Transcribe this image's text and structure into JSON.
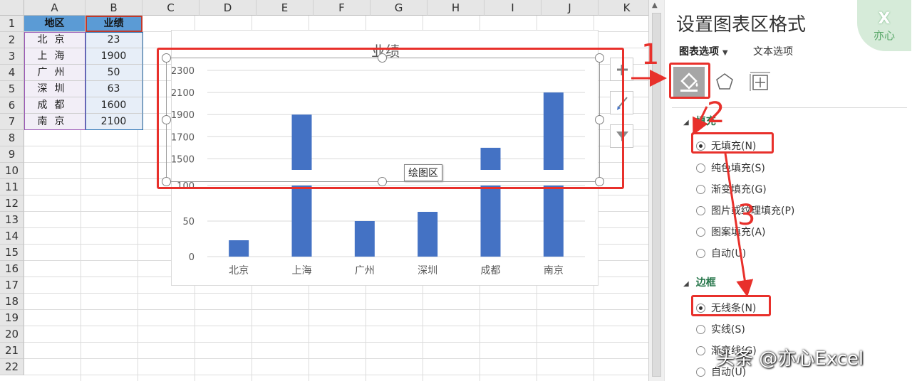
{
  "spreadsheet": {
    "columns": [
      "A",
      "B",
      "C",
      "D",
      "E",
      "F",
      "G",
      "H",
      "I",
      "J",
      "K"
    ],
    "rows": [
      "1",
      "2",
      "3",
      "4",
      "5",
      "6",
      "7",
      "8",
      "9",
      "10",
      "11",
      "12",
      "13",
      "14",
      "15",
      "16",
      "17",
      "18",
      "19",
      "20",
      "21",
      "22"
    ],
    "header": {
      "region": "地区",
      "sales": "业绩"
    },
    "data_rows": [
      {
        "region": "北京",
        "value": "23"
      },
      {
        "region": "上海",
        "value": "1900"
      },
      {
        "region": "广州",
        "value": "50"
      },
      {
        "region": "深圳",
        "value": "63"
      },
      {
        "region": "成都",
        "value": "1600"
      },
      {
        "region": "南京",
        "value": "2100"
      }
    ]
  },
  "chart_data": {
    "type": "bar",
    "title": "业绩",
    "categories": [
      "北京",
      "上海",
      "广州",
      "深圳",
      "成都",
      "南京"
    ],
    "values": [
      23,
      1900,
      50,
      63,
      1600,
      2100
    ],
    "axis_break": true,
    "upper_ylim": [
      1400,
      2300
    ],
    "upper_ticks": [
      "2300",
      "2100",
      "1900",
      "1700",
      "1500"
    ],
    "lower_ylim": [
      0,
      100
    ],
    "lower_ticks": [
      "100",
      "50",
      "0"
    ],
    "color": "#4472c4",
    "grid": true
  },
  "chart_ui": {
    "plot_area_tooltip": "绘图区",
    "side_buttons": [
      "plus-icon",
      "brush-icon",
      "filter-icon"
    ]
  },
  "annotations": {
    "step1": "1",
    "step2": "2",
    "step3": "3",
    "color": "#e8302b"
  },
  "panel": {
    "title": "设置图表区格式",
    "tab_chart_options": "图表选项",
    "tab_text_options": "文本选项",
    "icons": [
      "fill-line-icon",
      "effects-icon",
      "size-properties-icon"
    ],
    "fill_section": "填充",
    "fill_options": [
      {
        "label": "无填充(N)",
        "selected": true
      },
      {
        "label": "纯色填充(S)",
        "selected": false
      },
      {
        "label": "渐变填充(G)",
        "selected": false
      },
      {
        "label": "图片或纹理填充(P)",
        "selected": false
      },
      {
        "label": "图案填充(A)",
        "selected": false
      },
      {
        "label": "自动(U)",
        "selected": false
      }
    ],
    "border_section": "边框",
    "border_options": [
      {
        "label": "无线条(N)",
        "selected": true
      },
      {
        "label": "实线(S)",
        "selected": false
      },
      {
        "label": "渐变线(G)",
        "selected": false
      },
      {
        "label": "自动(U)",
        "selected": false
      }
    ]
  },
  "watermark": {
    "text": "头条 @亦心Excel",
    "logo_text": "亦心",
    "logo_letter": "X"
  },
  "accent_green": "#217346"
}
